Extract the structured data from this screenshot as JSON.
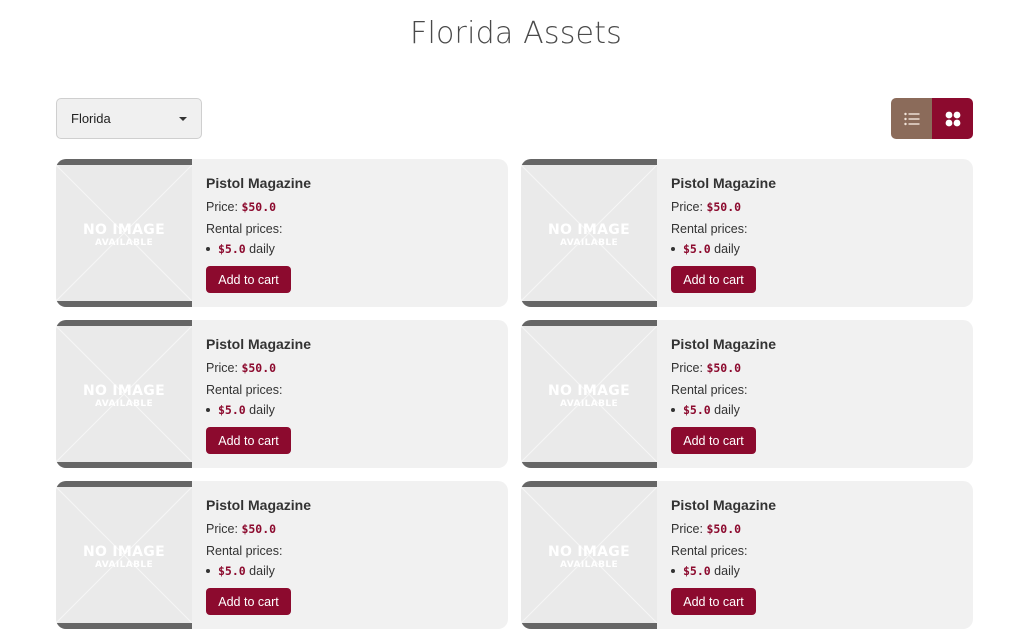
{
  "header": {
    "title": "Florida Assets"
  },
  "filter": {
    "selected_region": "Florida"
  },
  "view_toggle": {
    "active": "grid",
    "list_icon": "list-icon",
    "grid_icon": "grid-icon"
  },
  "colors": {
    "accent": "#8c0a2e",
    "list_toggle": "#8b6b5a",
    "card_bg": "#f1f1f1"
  },
  "products": [
    {
      "name": "Pistol Magazine",
      "price_label": "Price: ",
      "price": "$50.0",
      "rental_label": "Rental prices:",
      "rental_price": "$5.0",
      "rental_period": " daily",
      "button_label": "Add to cart",
      "image_text": "NO IMAGE",
      "image_subtext": "AVAILABLE"
    },
    {
      "name": "Pistol Magazine",
      "price_label": "Price: ",
      "price": "$50.0",
      "rental_label": "Rental prices:",
      "rental_price": "$5.0",
      "rental_period": " daily",
      "button_label": "Add to cart",
      "image_text": "NO IMAGE",
      "image_subtext": "AVAILABLE"
    },
    {
      "name": "Pistol Magazine",
      "price_label": "Price: ",
      "price": "$50.0",
      "rental_label": "Rental prices:",
      "rental_price": "$5.0",
      "rental_period": " daily",
      "button_label": "Add to cart",
      "image_text": "NO IMAGE",
      "image_subtext": "AVAILABLE"
    },
    {
      "name": "Pistol Magazine",
      "price_label": "Price: ",
      "price": "$50.0",
      "rental_label": "Rental prices:",
      "rental_price": "$5.0",
      "rental_period": " daily",
      "button_label": "Add to cart",
      "image_text": "NO IMAGE",
      "image_subtext": "AVAILABLE"
    },
    {
      "name": "Pistol Magazine",
      "price_label": "Price: ",
      "price": "$50.0",
      "rental_label": "Rental prices:",
      "rental_price": "$5.0",
      "rental_period": " daily",
      "button_label": "Add to cart",
      "image_text": "NO IMAGE",
      "image_subtext": "AVAILABLE"
    },
    {
      "name": "Pistol Magazine",
      "price_label": "Price: ",
      "price": "$50.0",
      "rental_label": "Rental prices:",
      "rental_price": "$5.0",
      "rental_period": " daily",
      "button_label": "Add to cart",
      "image_text": "NO IMAGE",
      "image_subtext": "AVAILABLE"
    }
  ]
}
